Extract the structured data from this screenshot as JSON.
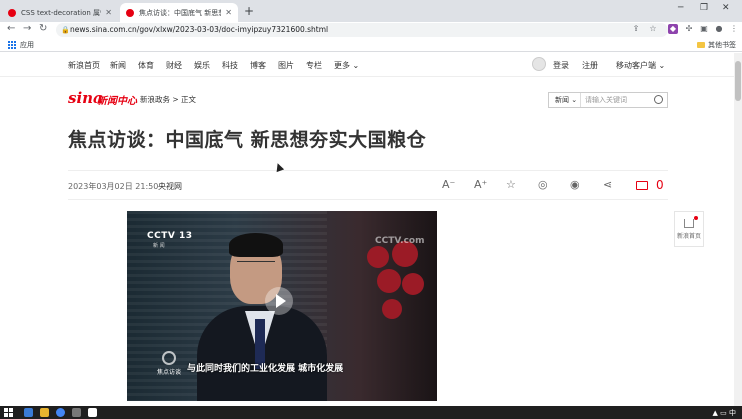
{
  "browser": {
    "tabs": [
      {
        "title": "CSS text-decoration 属性",
        "active": false
      },
      {
        "title": "焦点访谈：中国底气 新思想夯实...",
        "active": true
      }
    ],
    "new_tab": "+",
    "url": "news.sina.com.cn/gov/xlxw/2023-03-03/doc-imyipzuy7321600.shtml",
    "bookmarks": {
      "apps": "应用",
      "other": "其他书签"
    }
  },
  "site_nav": {
    "items": [
      "新浪首页",
      "新闻",
      "体育",
      "财经",
      "娱乐",
      "科技",
      "博客",
      "图片",
      "专栏",
      "更多"
    ],
    "login": "登录",
    "register": "注册",
    "mobile_client": "移动客户端"
  },
  "header": {
    "logo_text": "sina",
    "logo_sub": "新闻中心",
    "breadcrumb": "新浪政务 > 正文",
    "search_select": "新闻",
    "search_placeholder": "请输入关键词"
  },
  "article": {
    "title": "焦点访谈：中国底气 新思想夯实大国粮仓",
    "date": "2023年03月02日 21:50",
    "source": "央视网",
    "comment_count": "0"
  },
  "video": {
    "channel": "CCTV 13",
    "channel_sub": "新 闻",
    "watermark": "CCTV.com",
    "program": "焦点访谈",
    "subtitle": "与此同时我们的工业化发展  城市化发展"
  },
  "side": {
    "home_label": "新浪首页"
  },
  "colors": {
    "brand_red": "#e60012"
  }
}
